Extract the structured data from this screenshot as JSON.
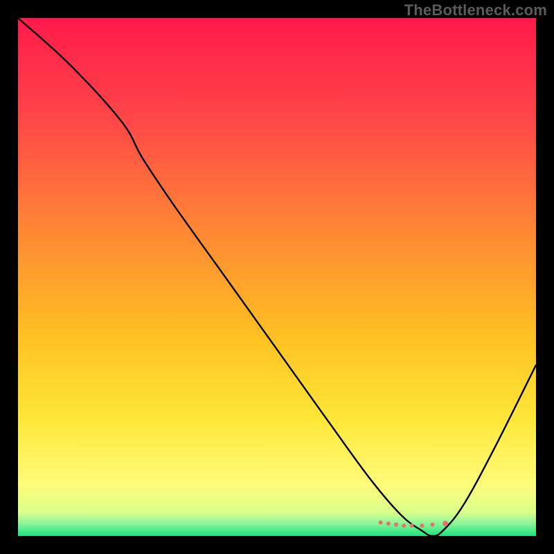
{
  "watermark": "TheBottleneck.com",
  "chart_data": {
    "type": "line",
    "title": "",
    "xlabel": "",
    "ylabel": "",
    "xlim": [
      0,
      100
    ],
    "ylim": [
      0,
      100
    ],
    "grid": false,
    "legend": false,
    "background_gradient": {
      "stops": [
        {
          "pos": 0.0,
          "color": "#ff1a4b"
        },
        {
          "pos": 0.2,
          "color": "#ff4848"
        },
        {
          "pos": 0.42,
          "color": "#ff8a33"
        },
        {
          "pos": 0.62,
          "color": "#ffc222"
        },
        {
          "pos": 0.78,
          "color": "#ffe83a"
        },
        {
          "pos": 0.9,
          "color": "#fffc7a"
        },
        {
          "pos": 0.955,
          "color": "#d9ff8a"
        },
        {
          "pos": 0.975,
          "color": "#8ef59a"
        },
        {
          "pos": 1.0,
          "color": "#19e27e"
        }
      ]
    },
    "series": [
      {
        "name": "curve",
        "stroke": "#000000",
        "x": [
          0,
          10,
          20,
          24,
          30,
          40,
          50,
          60,
          68,
          74,
          78,
          80,
          82,
          86,
          92,
          100
        ],
        "y": [
          100,
          91,
          80,
          73,
          64,
          50,
          36,
          22,
          11,
          4,
          1,
          0,
          1,
          6,
          17,
          33
        ]
      }
    ],
    "dots": {
      "color": "#e77368",
      "radius_small": 3.0,
      "radius_big": 4.0,
      "points": [
        {
          "x": 70.0,
          "y": 2.6,
          "big": false
        },
        {
          "x": 71.5,
          "y": 2.4,
          "big": false
        },
        {
          "x": 73.0,
          "y": 2.2,
          "big": false
        },
        {
          "x": 74.5,
          "y": 2.0,
          "big": false
        },
        {
          "x": 76.0,
          "y": 2.0,
          "big": false
        },
        {
          "x": 78.0,
          "y": 2.0,
          "big": false
        },
        {
          "x": 80.0,
          "y": 2.2,
          "big": false
        },
        {
          "x": 82.5,
          "y": 2.4,
          "big": true
        }
      ]
    }
  }
}
